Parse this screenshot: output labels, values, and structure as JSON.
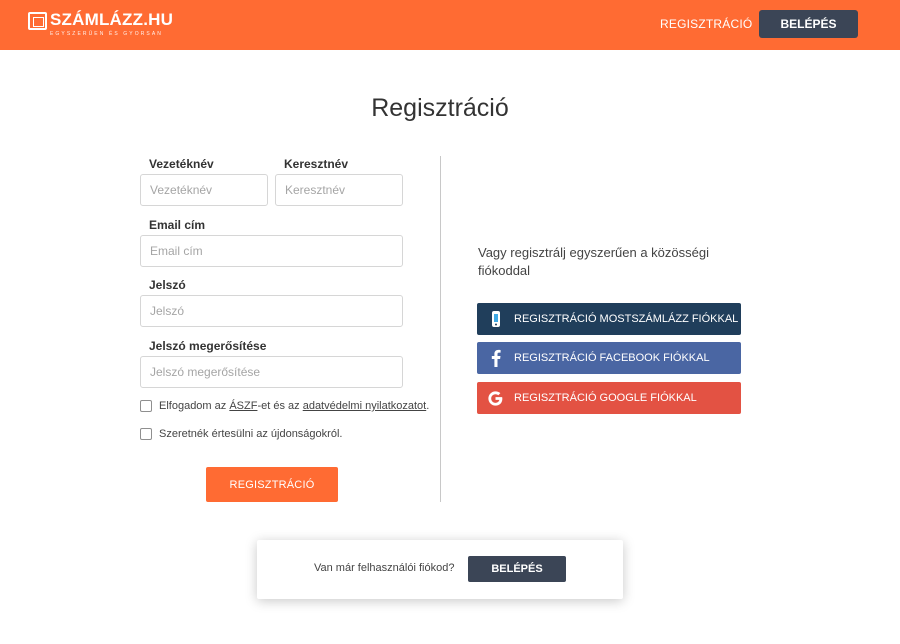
{
  "header": {
    "logo_text": "SZÁMLÁZZ.HU",
    "logo_tagline": "EGYSZERŰEN ÉS GYORSAN",
    "register_link": "REGISZTRÁCIÓ",
    "login_button": "BELÉPÉS"
  },
  "page_title": "Regisztráció",
  "form": {
    "last_name": {
      "label": "Vezetéknév",
      "placeholder": "Vezetéknév",
      "value": ""
    },
    "first_name": {
      "label": "Keresztnév",
      "placeholder": "Keresztnév",
      "value": ""
    },
    "email": {
      "label": "Email cím",
      "placeholder": "Email cím",
      "value": ""
    },
    "password": {
      "label": "Jelszó",
      "placeholder": "Jelszó",
      "value": ""
    },
    "password_confirm": {
      "label": "Jelszó megerősítése",
      "placeholder": "Jelszó megerősítése",
      "value": ""
    },
    "terms": {
      "prefix": "Elfogadom az ",
      "aszf_link": "ÁSZF",
      "middle": "-et és az ",
      "privacy_link": "adatvédelmi nyilatkozatot",
      "suffix": ".",
      "checked": false
    },
    "newsletter": {
      "label": "Szeretnék értesülni az újdonságokról.",
      "checked": false
    },
    "submit_label": "REGISZTRÁCIÓ"
  },
  "social": {
    "intro": "Vagy regisztrálj egyszerűen a közösségi fiókoddal",
    "buttons": [
      {
        "label": "REGISZTRÁCIÓ MOSTSZÁMLÁZZ FIÓKKAL",
        "icon": "mostszamlazz-icon",
        "color": "#203e5b"
      },
      {
        "label": "REGISZTRÁCIÓ FACEBOOK FIÓKKAL",
        "icon": "facebook-icon",
        "color": "#4a66a3"
      },
      {
        "label": "REGISZTRÁCIÓ GOOGLE FIÓKKAL",
        "icon": "google-icon",
        "color": "#e35243"
      }
    ]
  },
  "login_prompt": {
    "text": "Van már felhasználói fiókod?",
    "button": "BELÉPÉS"
  },
  "colors": {
    "brand_orange": "#ff6b33",
    "dark_button": "#3b4556"
  }
}
